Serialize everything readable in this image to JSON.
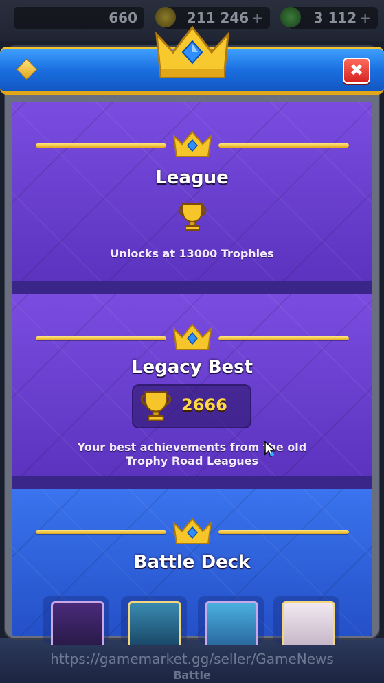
{
  "resources": {
    "first": "660",
    "gold": "211 246",
    "gems": "3 112",
    "plus": "+"
  },
  "modal": {
    "close_label": "✖"
  },
  "league": {
    "title": "League",
    "subtitle": "Unlocks at 13000 Trophies"
  },
  "legacy": {
    "title": "Legacy Best",
    "record": "2666",
    "desc_line1": "Your best achievements from the old",
    "desc_line2": "Trophy Road Leagues"
  },
  "deck": {
    "title": "Battle Deck"
  },
  "footer": {
    "watermark": "https://gamemarket.gg/seller/GameNews",
    "battle_label": "Battle"
  },
  "colors": {
    "header_blue": "#1a6fe0",
    "gold": "#f0c431",
    "panel_purple": "#6a3fd1",
    "panel_blue": "#3067e0",
    "close_red": "#d42222"
  },
  "icons": [
    "diamond-icon",
    "crown-icon",
    "close-icon",
    "trophy-icon",
    "cursor-icon"
  ]
}
